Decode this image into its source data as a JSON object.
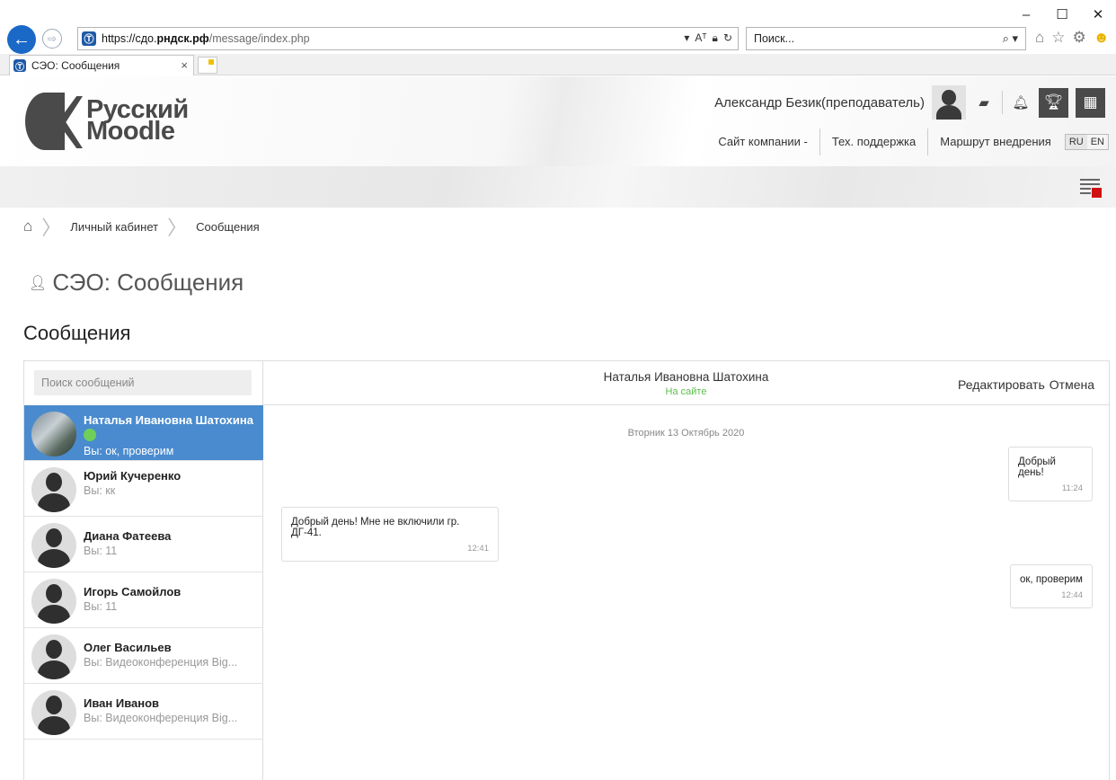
{
  "browser": {
    "url_prefix": "https://сдо.",
    "url_domain": "рндск.рф",
    "url_path": "/message/index.php",
    "search_placeholder": "Поиск...",
    "tab_title": "СЭО: Сообщения",
    "win_min": "–",
    "win_max": "☐",
    "win_close": "✕"
  },
  "header": {
    "logo_line1": "Русский",
    "logo_line2": "Moodle",
    "user_name": "Александр Безик(преподаватель)",
    "links": [
      "Сайт компании -",
      "Тех. поддержка",
      "Маршрут внедрения"
    ],
    "lang_ru": "RU",
    "lang_en": "EN"
  },
  "breadcrumb": {
    "items": [
      "Личный кабинет",
      "Сообщения"
    ]
  },
  "page": {
    "title": "СЭО: Сообщения",
    "section_title": "Сообщения"
  },
  "messages": {
    "search_placeholder": "Поиск сообщений",
    "contacts": [
      {
        "name": "Наталья Ивановна Шатохина",
        "preview": "Вы: ок, проверим"
      },
      {
        "name": "Юрий Кучеренко",
        "preview": "Вы: кк"
      },
      {
        "name": "Диана Фатеева",
        "preview": "Вы: 11"
      },
      {
        "name": "Игорь Самойлов",
        "preview": "Вы: 11"
      },
      {
        "name": "Олег Васильев",
        "preview": "Вы: Видеоконференция Big..."
      },
      {
        "name": "Иван Иванов",
        "preview": "Вы: Видеоконференция Big..."
      }
    ],
    "conversation": {
      "name": "Наталья Ивановна Шатохина",
      "status": "На сайте",
      "edit_label": "Редактировать",
      "cancel_label": "Отмена",
      "day": "Вторник 13 Октябрь 2020",
      "items": [
        {
          "text": "Добрый день!",
          "time": "11:24",
          "side": "right"
        },
        {
          "text": "Добрый день! Мне не включили гр. ДГ-41.",
          "time": "12:41",
          "side": "left"
        },
        {
          "text": "ок, проверим",
          "time": "12:44",
          "side": "right"
        }
      ]
    }
  },
  "colors": {
    "active_contact": "#4a8bcf",
    "online": "#5cbf4b",
    "accent_flag": "#d01010"
  }
}
